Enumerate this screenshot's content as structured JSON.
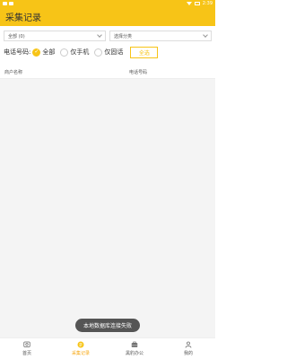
{
  "status_bar": {
    "time": "2:39"
  },
  "app_bar": {
    "title": "采集记录"
  },
  "filters": {
    "type_select": {
      "value": "全部 (0)"
    },
    "category_select": {
      "value": "选择分类"
    }
  },
  "phone_filter": {
    "label": "电话号码:",
    "options": [
      {
        "label": "全部",
        "checked": true
      },
      {
        "label": "仅手机",
        "checked": false
      },
      {
        "label": "仅固话",
        "checked": false
      }
    ],
    "select_all_label": "全选"
  },
  "table": {
    "columns": [
      "商户名称",
      "电话号码"
    ],
    "rows": []
  },
  "toast": {
    "message": "本地数据库连接失败"
  },
  "bottom_nav": {
    "items": [
      {
        "label": "首页",
        "icon": "home-icon",
        "active": false
      },
      {
        "label": "采集记录",
        "icon": "records-icon",
        "active": true
      },
      {
        "label": "黑豹办公",
        "icon": "briefcase-icon",
        "active": false
      },
      {
        "label": "我的",
        "icon": "profile-icon",
        "active": false
      }
    ]
  },
  "colors": {
    "accent": "#f7c417",
    "active_nav": "#f7a917",
    "toast_bg": "#555555"
  }
}
